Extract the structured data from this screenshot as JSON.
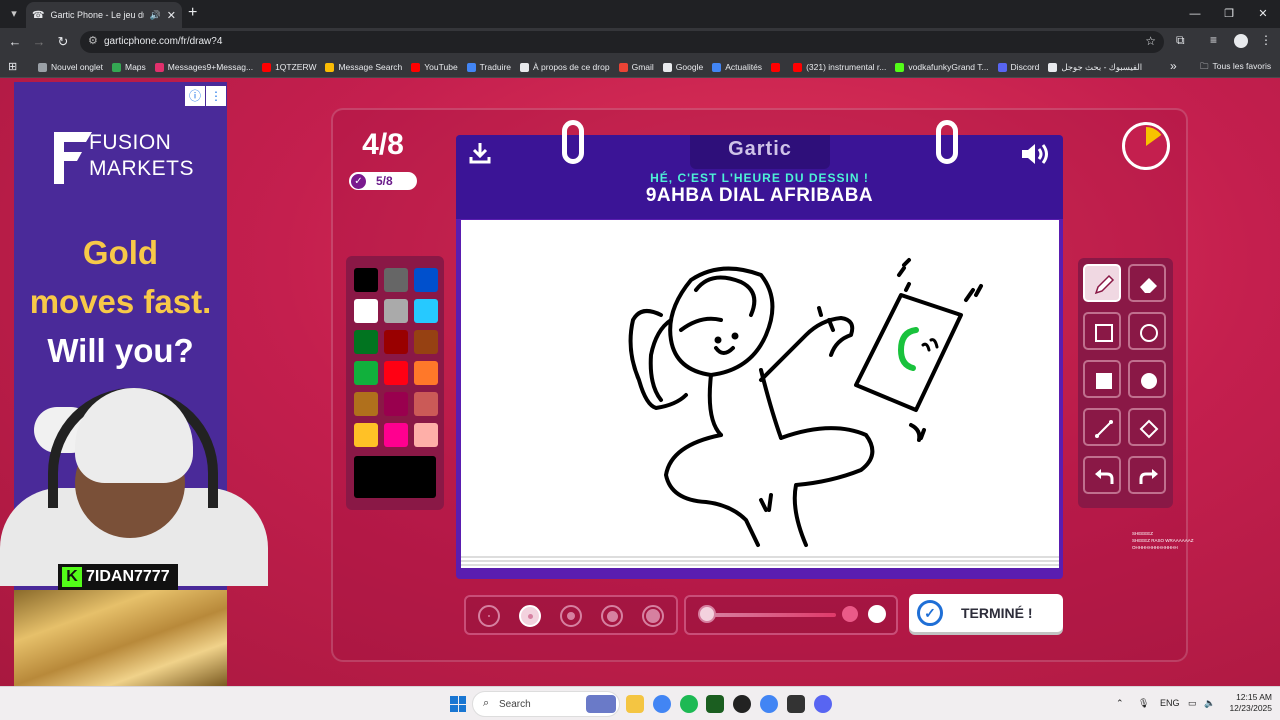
{
  "browser": {
    "tab_title": "Gartic Phone - Le jeu du télé",
    "url": "garticphone.com/fr/draw?4",
    "bookmarks": [
      {
        "label": "Nouvel onglet",
        "color": "#9aa0a6"
      },
      {
        "label": "Maps",
        "color": "#34a853"
      },
      {
        "label": "Messages9+Messag...",
        "color": "#e1306c"
      },
      {
        "label": "1QTZERW",
        "color": "#ff0000"
      },
      {
        "label": "Message Search",
        "color": "#fbbc04"
      },
      {
        "label": "YouTube",
        "color": "#ff0000"
      },
      {
        "label": "Traduire",
        "color": "#4285f4"
      },
      {
        "label": "À propos de ce drop",
        "color": "#e8eaed"
      },
      {
        "label": "Gmail",
        "color": "#ea4335"
      },
      {
        "label": "Google",
        "color": "#e8eaed"
      },
      {
        "label": "Actualités",
        "color": "#4285f4"
      },
      {
        "label": "",
        "color": "#ff0000"
      },
      {
        "label": "(321) instrumental r...",
        "color": "#ff0000"
      },
      {
        "label": "vodkafunkyGrand T...",
        "color": "#53fc18"
      },
      {
        "label": "Discord",
        "color": "#5865f2"
      },
      {
        "label": "الفيسبوك - بحث جوجل",
        "color": "#e8eaed"
      }
    ],
    "all_bookmarks": "Tous les favoris"
  },
  "ad": {
    "brand": "FUSION\nMARKETS",
    "line1": "Gold",
    "line2": "moves fast.",
    "line3": "Will you?"
  },
  "stream": {
    "username": "7IDAN7777",
    "chat_lines": [
      "SHEEEEZ",
      "SHEEEZ RASO WRAAAAAAZ",
      "OHHHHHHHHHHHHH",
      "",
      ""
    ]
  },
  "game": {
    "round": "4/8",
    "done_count": "5/8",
    "logo": "Gartic",
    "prompt_header": "HÉ, C'EST L'HEURE DU DESSIN !",
    "prompt": "9AHBA DIAL AFRIBABA",
    "done_button": "TERMINÉ !",
    "timer_remaining_fraction": 0.85,
    "selected_color": "#000000",
    "palette": [
      [
        "#000000",
        "#666666",
        "#0050cd"
      ],
      [
        "#ffffff",
        "#aaaaaa",
        "#26c9ff"
      ],
      [
        "#017420",
        "#990000",
        "#964112"
      ],
      [
        "#11b03c",
        "#ff0013",
        "#ff7829"
      ],
      [
        "#b0701c",
        "#99004e",
        "#cb5a57"
      ],
      [
        "#ffc126",
        "#ff008f",
        "#feafa8"
      ]
    ],
    "tools": [
      "pencil",
      "eraser",
      "rectangle",
      "ellipse",
      "filled-rectangle",
      "filled-ellipse",
      "line",
      "fill-bucket",
      "undo",
      "redo"
    ],
    "active_tool": "pencil",
    "brush_sizes": 5,
    "selected_brush_size": 2,
    "opacity": 1.0
  },
  "taskbar": {
    "search_placeholder": "Search",
    "lang": "ENG",
    "time": "12:15 AM",
    "date": "12/23/2025"
  }
}
